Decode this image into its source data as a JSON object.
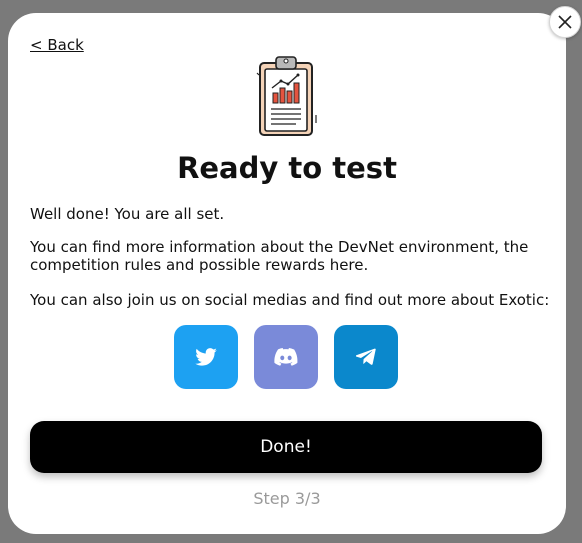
{
  "modal": {
    "back_label": "< Back",
    "title": "Ready to test",
    "paragraphs": [
      "Well done! You are all set.",
      "You can find more information about the DevNet environment, the competition rules and possible rewards here.",
      "You can also join us on social medias and find out more about Exotic:"
    ],
    "social": [
      {
        "name": "twitter",
        "icon": "twitter-icon",
        "color": "#1da1f2"
      },
      {
        "name": "discord",
        "icon": "discord-icon",
        "color": "#7a8ad9"
      },
      {
        "name": "telegram",
        "icon": "telegram-icon",
        "color": "#0b88cc"
      }
    ],
    "done_label": "Done!",
    "step_text": "Step 3/3",
    "close_icon": "close-icon",
    "illustration_icon": "clipboard-chart-icon"
  }
}
